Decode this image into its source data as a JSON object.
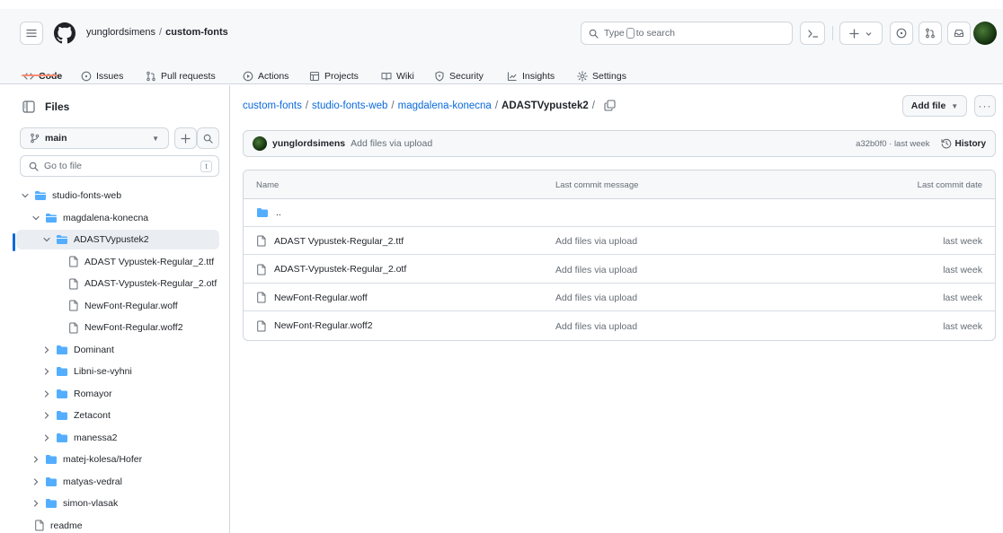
{
  "header": {
    "owner": "yunglordsimens",
    "separator": "/",
    "repo": "custom-fonts",
    "search_prefix": "Type",
    "search_suffix": "to search"
  },
  "nav": {
    "tabs": [
      {
        "label": "Code",
        "icon": "code-icon",
        "active": true
      },
      {
        "label": "Issues",
        "icon": "issue-icon"
      },
      {
        "label": "Pull requests",
        "icon": "pull-request-icon"
      },
      {
        "label": "Actions",
        "icon": "play-icon"
      },
      {
        "label": "Projects",
        "icon": "table-icon"
      },
      {
        "label": "Wiki",
        "icon": "book-icon"
      },
      {
        "label": "Security",
        "icon": "shield-icon"
      },
      {
        "label": "Insights",
        "icon": "graph-icon"
      },
      {
        "label": "Settings",
        "icon": "gear-icon"
      }
    ]
  },
  "sidebar": {
    "title": "Files",
    "branch": "main",
    "goto_placeholder": "Go to file",
    "goto_shortcut": "t",
    "tree": [
      {
        "label": "studio-fonts-web",
        "type": "folder",
        "expanded": true
      },
      {
        "label": "magdalena-konecna",
        "type": "folder",
        "expanded": true
      },
      {
        "label": "ADASTVypustek2",
        "type": "folder",
        "expanded": true,
        "selected": true
      },
      {
        "label": "ADAST Vypustek-Regular_2.ttf",
        "type": "file"
      },
      {
        "label": "ADAST-Vypustek-Regular_2.otf",
        "type": "file"
      },
      {
        "label": "NewFont-Regular.woff",
        "type": "file"
      },
      {
        "label": "NewFont-Regular.woff2",
        "type": "file"
      },
      {
        "label": "Dominant",
        "type": "folder",
        "expanded": false
      },
      {
        "label": "Libni-se-vyhni",
        "type": "folder",
        "expanded": false
      },
      {
        "label": "Romayor",
        "type": "folder",
        "expanded": false
      },
      {
        "label": "Zetacont",
        "type": "folder",
        "expanded": false
      },
      {
        "label": "manessa2",
        "type": "folder",
        "expanded": false
      },
      {
        "label": "matej-kolesa/Hofer",
        "type": "folder",
        "expanded": false
      },
      {
        "label": "matyas-vedral",
        "type": "folder",
        "expanded": false
      },
      {
        "label": "simon-vlasak",
        "type": "folder",
        "expanded": false
      },
      {
        "label": "readme",
        "type": "file"
      }
    ]
  },
  "main": {
    "path": {
      "parts": [
        "custom-fonts",
        "studio-fonts-web",
        "magdalena-konecna"
      ],
      "current": "ADASTVypustek2",
      "trailing": "/"
    },
    "add_file_label": "Add file",
    "more_label": "···",
    "commit": {
      "author": "yunglordsimens",
      "message": "Add files via upload",
      "meta": "a32b0f0 · last week",
      "history_label": "History"
    },
    "table": {
      "headers": [
        "Name",
        "Last commit message",
        "Last commit date"
      ],
      "parent_label": "..",
      "rows": [
        {
          "name": "ADAST Vypustek-Regular_2.ttf",
          "message": "Add files via upload",
          "date": "last week"
        },
        {
          "name": "ADAST-Vypustek-Regular_2.otf",
          "message": "Add files via upload",
          "date": "last week"
        },
        {
          "name": "NewFont-Regular.woff",
          "message": "Add files via upload",
          "date": "last week"
        },
        {
          "name": "NewFont-Regular.woff2",
          "message": "Add files via upload",
          "date": "last week"
        }
      ]
    }
  },
  "colors": {
    "link": "#0969da",
    "folder": "#54aeff",
    "accent_underline": "#fd8c73",
    "border": "#d0d7de",
    "muted": "#656d76"
  }
}
